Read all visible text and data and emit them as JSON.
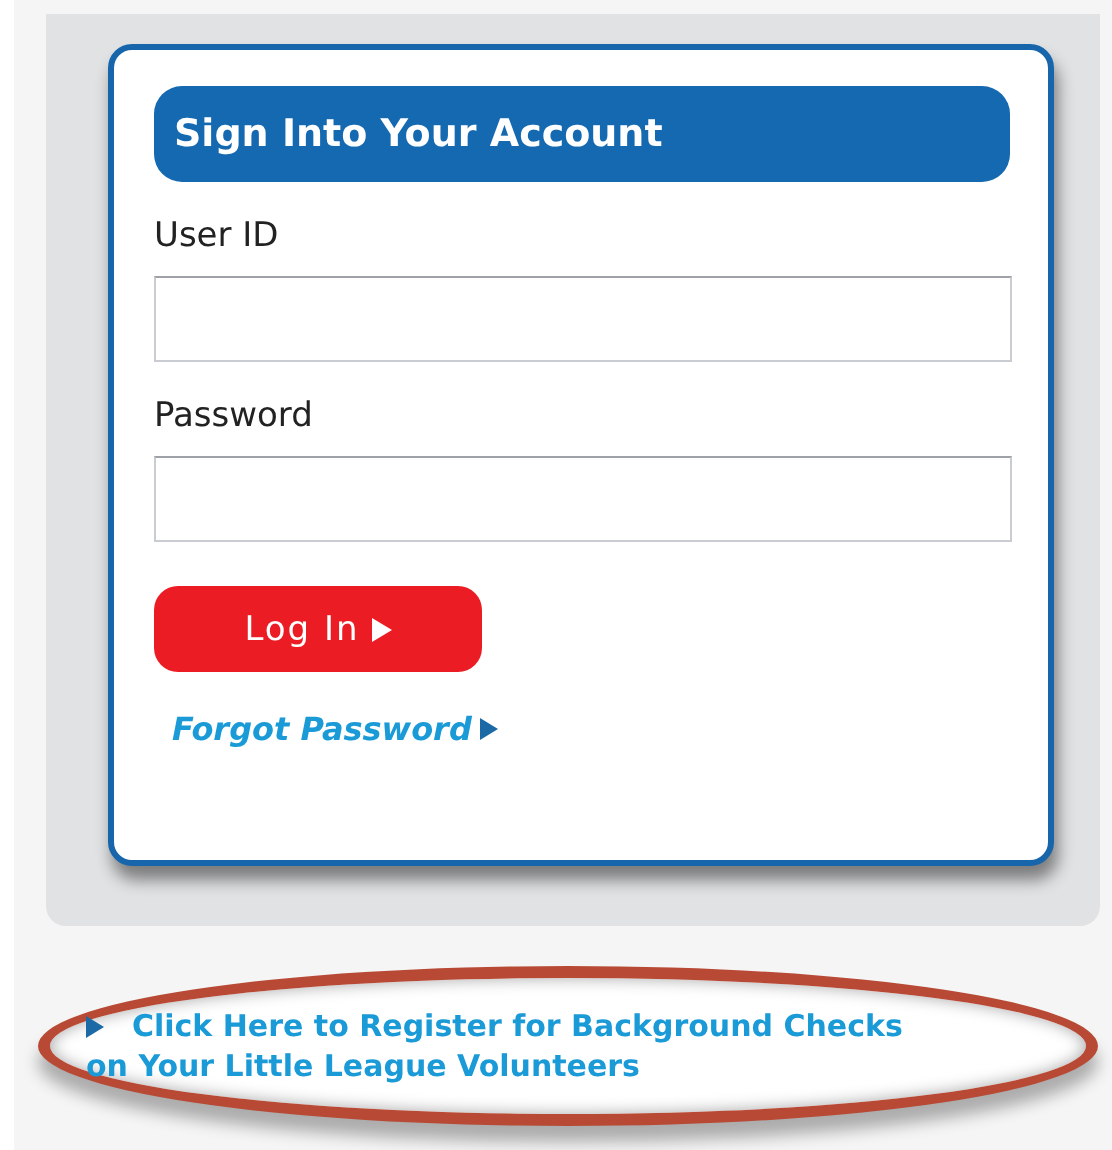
{
  "login_card": {
    "title": "Sign Into Your Account",
    "fields": [
      {
        "label": "User ID"
      },
      {
        "label": "Password"
      }
    ],
    "login_button": "Log In",
    "forgot_link": "Forgot Password"
  },
  "register_link": {
    "line_1": "Click Here to Register for Background Checks",
    "line_2": "on Your Little League Volunteers"
  }
}
